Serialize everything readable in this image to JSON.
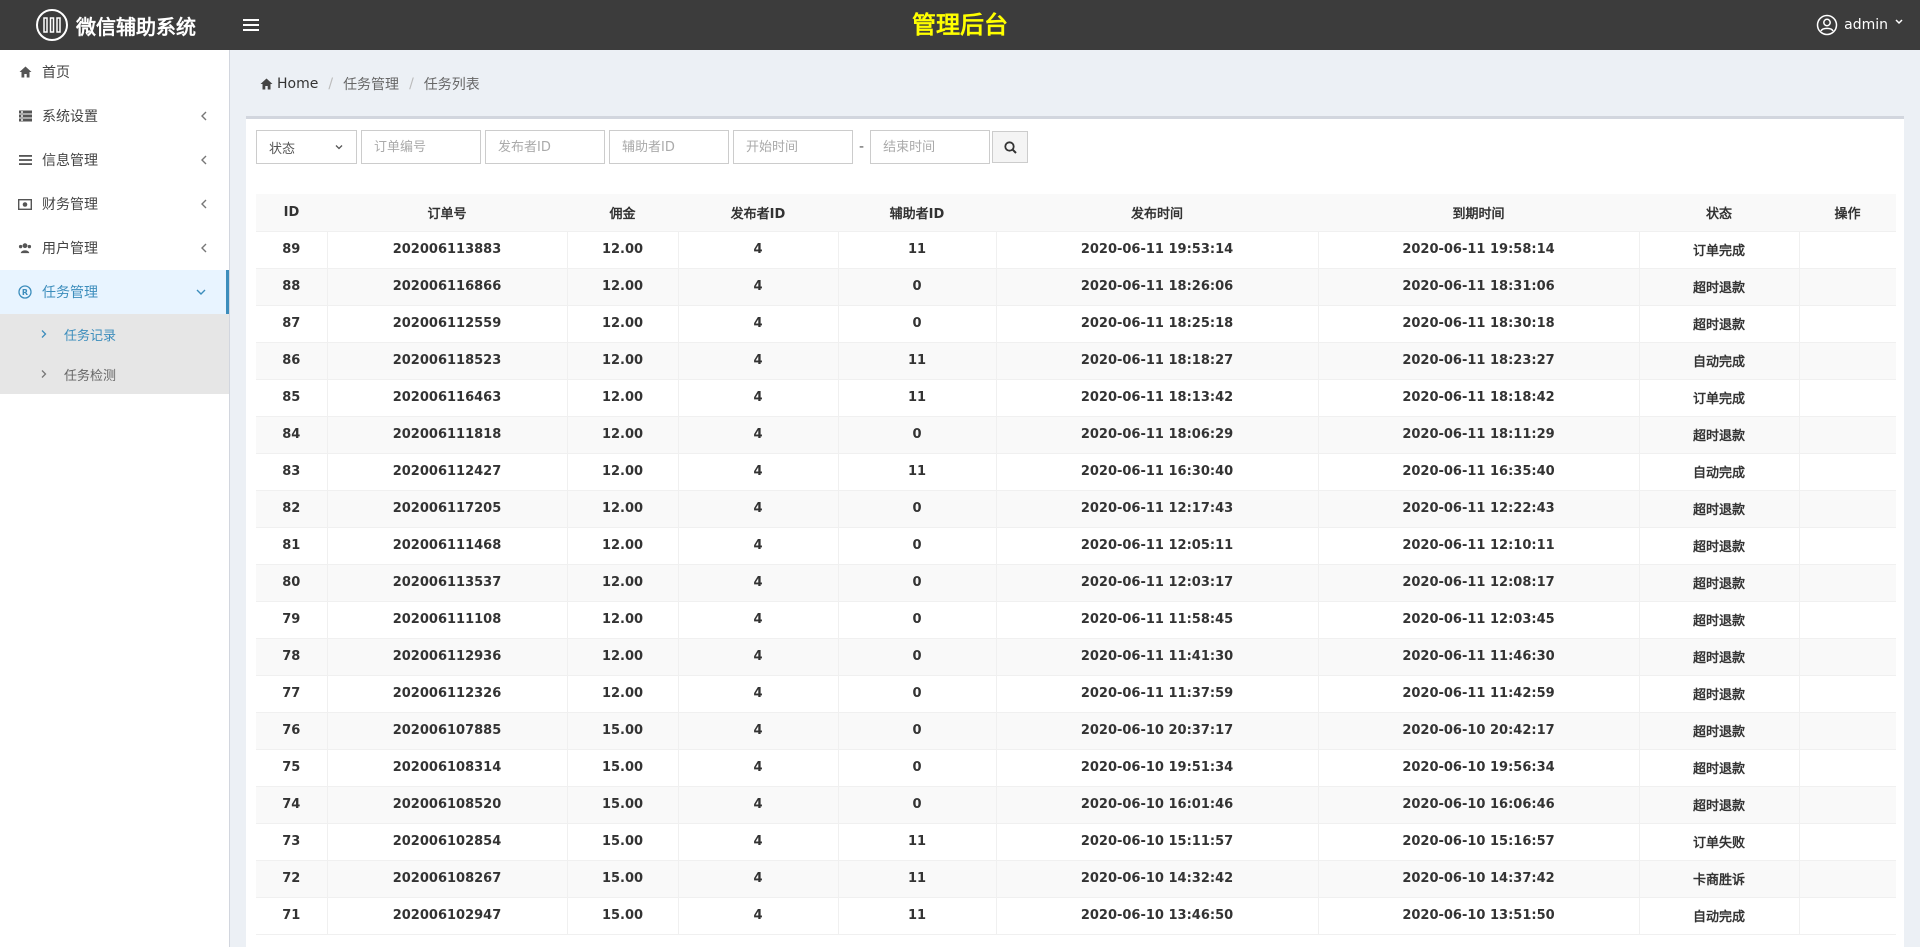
{
  "app": {
    "brand_title": "微信辅助系统",
    "header_title": "管理后台",
    "user_name": "admin",
    "accent_color": "#3c8dbc",
    "header_title_color": "#ffff00"
  },
  "sidebar": {
    "items": [
      {
        "label": "首页",
        "icon": "home-icon"
      },
      {
        "label": "系统设置",
        "icon": "settings-list-icon"
      },
      {
        "label": "信息管理",
        "icon": "list-icon"
      },
      {
        "label": "财务管理",
        "icon": "money-icon"
      },
      {
        "label": "用户管理",
        "icon": "users-icon"
      },
      {
        "label": "任务管理",
        "icon": "registered-icon"
      }
    ],
    "submenu": [
      {
        "label": "任务记录"
      },
      {
        "label": "任务检测"
      }
    ]
  },
  "breadcrumb": {
    "home": "Home",
    "level1": "任务管理",
    "level2": "任务列表"
  },
  "filters": {
    "status_label": "状态",
    "order_no_placeholder": "订单编号",
    "publisher_placeholder": "发布者ID",
    "assistant_placeholder": "辅助者ID",
    "start_placeholder": "开始时间",
    "end_placeholder": "结束时间",
    "range_separator": "-"
  },
  "table": {
    "columns": [
      "ID",
      "订单号",
      "佣金",
      "发布者ID",
      "辅助者ID",
      "发布时间",
      "到期时间",
      "状态",
      "操作"
    ],
    "rows": [
      [
        "89",
        "202006113883",
        "12.00",
        "4",
        "11",
        "2020-06-11 19:53:14",
        "2020-06-11 19:58:14",
        "订单完成",
        ""
      ],
      [
        "88",
        "202006116866",
        "12.00",
        "4",
        "0",
        "2020-06-11 18:26:06",
        "2020-06-11 18:31:06",
        "超时退款",
        ""
      ],
      [
        "87",
        "202006112559",
        "12.00",
        "4",
        "0",
        "2020-06-11 18:25:18",
        "2020-06-11 18:30:18",
        "超时退款",
        ""
      ],
      [
        "86",
        "202006118523",
        "12.00",
        "4",
        "11",
        "2020-06-11 18:18:27",
        "2020-06-11 18:23:27",
        "自动完成",
        ""
      ],
      [
        "85",
        "202006116463",
        "12.00",
        "4",
        "11",
        "2020-06-11 18:13:42",
        "2020-06-11 18:18:42",
        "订单完成",
        ""
      ],
      [
        "84",
        "202006111818",
        "12.00",
        "4",
        "0",
        "2020-06-11 18:06:29",
        "2020-06-11 18:11:29",
        "超时退款",
        ""
      ],
      [
        "83",
        "202006112427",
        "12.00",
        "4",
        "11",
        "2020-06-11 16:30:40",
        "2020-06-11 16:35:40",
        "自动完成",
        ""
      ],
      [
        "82",
        "202006117205",
        "12.00",
        "4",
        "0",
        "2020-06-11 12:17:43",
        "2020-06-11 12:22:43",
        "超时退款",
        ""
      ],
      [
        "81",
        "202006111468",
        "12.00",
        "4",
        "0",
        "2020-06-11 12:05:11",
        "2020-06-11 12:10:11",
        "超时退款",
        ""
      ],
      [
        "80",
        "202006113537",
        "12.00",
        "4",
        "0",
        "2020-06-11 12:03:17",
        "2020-06-11 12:08:17",
        "超时退款",
        ""
      ],
      [
        "79",
        "202006111108",
        "12.00",
        "4",
        "0",
        "2020-06-11 11:58:45",
        "2020-06-11 12:03:45",
        "超时退款",
        ""
      ],
      [
        "78",
        "202006112936",
        "12.00",
        "4",
        "0",
        "2020-06-11 11:41:30",
        "2020-06-11 11:46:30",
        "超时退款",
        ""
      ],
      [
        "77",
        "202006112326",
        "12.00",
        "4",
        "0",
        "2020-06-11 11:37:59",
        "2020-06-11 11:42:59",
        "超时退款",
        ""
      ],
      [
        "76",
        "202006107885",
        "15.00",
        "4",
        "0",
        "2020-06-10 20:37:17",
        "2020-06-10 20:42:17",
        "超时退款",
        ""
      ],
      [
        "75",
        "202006108314",
        "15.00",
        "4",
        "0",
        "2020-06-10 19:51:34",
        "2020-06-10 19:56:34",
        "超时退款",
        ""
      ],
      [
        "74",
        "202006108520",
        "15.00",
        "4",
        "0",
        "2020-06-10 16:01:46",
        "2020-06-10 16:06:46",
        "超时退款",
        ""
      ],
      [
        "73",
        "202006102854",
        "15.00",
        "4",
        "11",
        "2020-06-10 15:11:57",
        "2020-06-10 15:16:57",
        "订单失败",
        ""
      ],
      [
        "72",
        "202006108267",
        "15.00",
        "4",
        "11",
        "2020-06-10 14:32:42",
        "2020-06-10 14:37:42",
        "卡商胜诉",
        ""
      ],
      [
        "71",
        "202006102947",
        "15.00",
        "4",
        "11",
        "2020-06-10 13:46:50",
        "2020-06-10 13:51:50",
        "自动完成",
        ""
      ]
    ]
  }
}
